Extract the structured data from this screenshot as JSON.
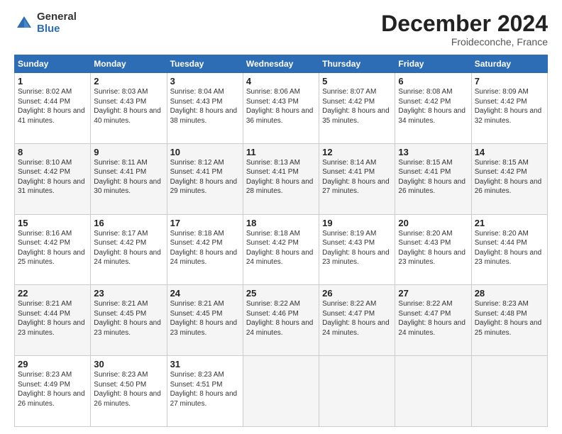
{
  "logo": {
    "general": "General",
    "blue": "Blue"
  },
  "header": {
    "title": "December 2024",
    "subtitle": "Froideconche, France"
  },
  "weekdays": [
    "Sunday",
    "Monday",
    "Tuesday",
    "Wednesday",
    "Thursday",
    "Friday",
    "Saturday"
  ],
  "weeks": [
    [
      {
        "day": "1",
        "sunrise": "8:02 AM",
        "sunset": "4:44 PM",
        "daylight": "8 hours and 41 minutes."
      },
      {
        "day": "2",
        "sunrise": "8:03 AM",
        "sunset": "4:43 PM",
        "daylight": "8 hours and 40 minutes."
      },
      {
        "day": "3",
        "sunrise": "8:04 AM",
        "sunset": "4:43 PM",
        "daylight": "8 hours and 38 minutes."
      },
      {
        "day": "4",
        "sunrise": "8:06 AM",
        "sunset": "4:43 PM",
        "daylight": "8 hours and 36 minutes."
      },
      {
        "day": "5",
        "sunrise": "8:07 AM",
        "sunset": "4:42 PM",
        "daylight": "8 hours and 35 minutes."
      },
      {
        "day": "6",
        "sunrise": "8:08 AM",
        "sunset": "4:42 PM",
        "daylight": "8 hours and 34 minutes."
      },
      {
        "day": "7",
        "sunrise": "8:09 AM",
        "sunset": "4:42 PM",
        "daylight": "8 hours and 32 minutes."
      }
    ],
    [
      {
        "day": "8",
        "sunrise": "8:10 AM",
        "sunset": "4:42 PM",
        "daylight": "8 hours and 31 minutes."
      },
      {
        "day": "9",
        "sunrise": "8:11 AM",
        "sunset": "4:41 PM",
        "daylight": "8 hours and 30 minutes."
      },
      {
        "day": "10",
        "sunrise": "8:12 AM",
        "sunset": "4:41 PM",
        "daylight": "8 hours and 29 minutes."
      },
      {
        "day": "11",
        "sunrise": "8:13 AM",
        "sunset": "4:41 PM",
        "daylight": "8 hours and 28 minutes."
      },
      {
        "day": "12",
        "sunrise": "8:14 AM",
        "sunset": "4:41 PM",
        "daylight": "8 hours and 27 minutes."
      },
      {
        "day": "13",
        "sunrise": "8:15 AM",
        "sunset": "4:41 PM",
        "daylight": "8 hours and 26 minutes."
      },
      {
        "day": "14",
        "sunrise": "8:15 AM",
        "sunset": "4:42 PM",
        "daylight": "8 hours and 26 minutes."
      }
    ],
    [
      {
        "day": "15",
        "sunrise": "8:16 AM",
        "sunset": "4:42 PM",
        "daylight": "8 hours and 25 minutes."
      },
      {
        "day": "16",
        "sunrise": "8:17 AM",
        "sunset": "4:42 PM",
        "daylight": "8 hours and 24 minutes."
      },
      {
        "day": "17",
        "sunrise": "8:18 AM",
        "sunset": "4:42 PM",
        "daylight": "8 hours and 24 minutes."
      },
      {
        "day": "18",
        "sunrise": "8:18 AM",
        "sunset": "4:42 PM",
        "daylight": "8 hours and 24 minutes."
      },
      {
        "day": "19",
        "sunrise": "8:19 AM",
        "sunset": "4:43 PM",
        "daylight": "8 hours and 23 minutes."
      },
      {
        "day": "20",
        "sunrise": "8:20 AM",
        "sunset": "4:43 PM",
        "daylight": "8 hours and 23 minutes."
      },
      {
        "day": "21",
        "sunrise": "8:20 AM",
        "sunset": "4:44 PM",
        "daylight": "8 hours and 23 minutes."
      }
    ],
    [
      {
        "day": "22",
        "sunrise": "8:21 AM",
        "sunset": "4:44 PM",
        "daylight": "8 hours and 23 minutes."
      },
      {
        "day": "23",
        "sunrise": "8:21 AM",
        "sunset": "4:45 PM",
        "daylight": "8 hours and 23 minutes."
      },
      {
        "day": "24",
        "sunrise": "8:21 AM",
        "sunset": "4:45 PM",
        "daylight": "8 hours and 23 minutes."
      },
      {
        "day": "25",
        "sunrise": "8:22 AM",
        "sunset": "4:46 PM",
        "daylight": "8 hours and 24 minutes."
      },
      {
        "day": "26",
        "sunrise": "8:22 AM",
        "sunset": "4:47 PM",
        "daylight": "8 hours and 24 minutes."
      },
      {
        "day": "27",
        "sunrise": "8:22 AM",
        "sunset": "4:47 PM",
        "daylight": "8 hours and 24 minutes."
      },
      {
        "day": "28",
        "sunrise": "8:23 AM",
        "sunset": "4:48 PM",
        "daylight": "8 hours and 25 minutes."
      }
    ],
    [
      {
        "day": "29",
        "sunrise": "8:23 AM",
        "sunset": "4:49 PM",
        "daylight": "8 hours and 26 minutes."
      },
      {
        "day": "30",
        "sunrise": "8:23 AM",
        "sunset": "4:50 PM",
        "daylight": "8 hours and 26 minutes."
      },
      {
        "day": "31",
        "sunrise": "8:23 AM",
        "sunset": "4:51 PM",
        "daylight": "8 hours and 27 minutes."
      },
      null,
      null,
      null,
      null
    ]
  ]
}
